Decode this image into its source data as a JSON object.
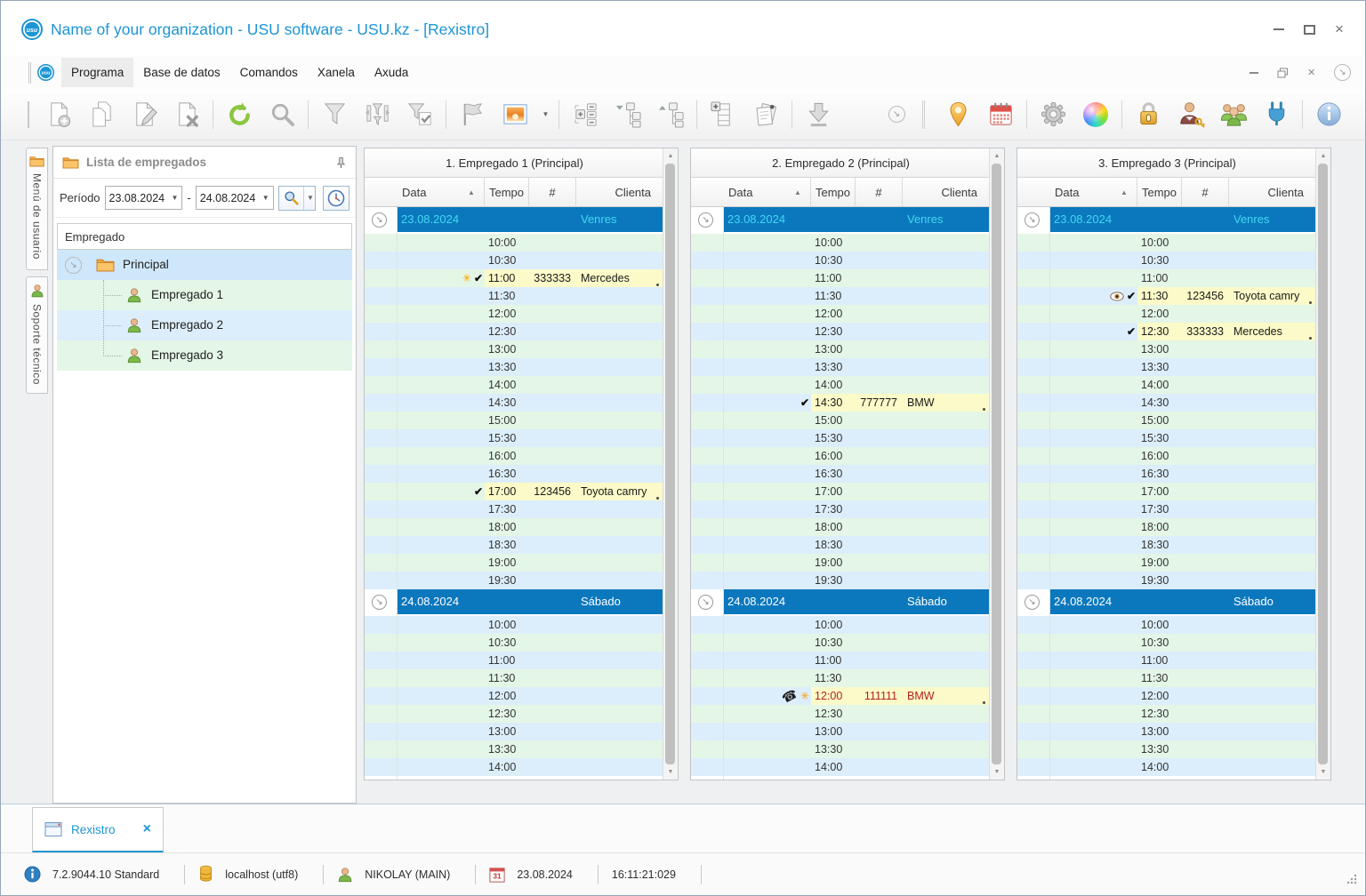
{
  "window": {
    "title": "Name of your organization - USU software - USU.kz - [Rexistro]"
  },
  "menu": {
    "items": [
      "Programa",
      "Base de datos",
      "Comandos",
      "Xanela",
      "Axuda"
    ],
    "active": "Programa"
  },
  "toolbar": {
    "icons": [
      "new-record",
      "copy-record",
      "edit-record",
      "delete-record",
      "refresh",
      "search",
      "filter",
      "filter-columns",
      "filter-apply",
      "flag",
      "image-preview",
      "dropdown",
      "row-expand",
      "tree-collapse",
      "tree-expand",
      "add-column",
      "reports",
      "import",
      "toolbar-overflow",
      "map-pin",
      "calendar",
      "settings",
      "color-scheme",
      "lock",
      "user-permissions",
      "employees",
      "plugins",
      "info",
      "toolbar-overflow"
    ]
  },
  "sidebar": {
    "tabs": [
      {
        "label": "Menú de usuario",
        "icon": "folder-icon"
      },
      {
        "label": "Soporte técnico",
        "icon": "user-icon"
      }
    ],
    "panel_title": "Lista de empregados",
    "period": {
      "label": "Período",
      "from": "23.08.2024",
      "to": "24.08.2024",
      "separator": "-"
    },
    "tree_header": "Empregado",
    "tree_root": "Principal",
    "employees": [
      "Empregado 1",
      "Empregado 2",
      "Empregado 3"
    ]
  },
  "schedule": {
    "columns": [
      "Data",
      "Tempo",
      "#",
      "Clienta"
    ],
    "day1_times": [
      "10:00",
      "10:30",
      "11:00",
      "11:30",
      "12:00",
      "12:30",
      "13:00",
      "13:30",
      "14:00",
      "14:30",
      "15:00",
      "15:30",
      "16:00",
      "16:30",
      "17:00",
      "17:30",
      "18:00",
      "18:30",
      "19:00",
      "19:30"
    ],
    "day2_times": [
      "10:00",
      "10:30",
      "11:00",
      "11:30",
      "12:00",
      "12:30",
      "13:00",
      "13:30",
      "14:00"
    ],
    "panels": [
      {
        "title": "1. Empregado 1 (Principal)",
        "days": [
          {
            "date": "23.08.2024",
            "weekday": "Venres",
            "current": true,
            "times": "day1",
            "entries": {
              "11:00": {
                "num": "333333",
                "client": "Mercedes",
                "icons": [
                  "asterisk",
                  "check"
                ]
              },
              "17:00": {
                "num": "123456",
                "client": "Toyota camry",
                "icons": [
                  "check"
                ]
              }
            }
          },
          {
            "date": "24.08.2024",
            "weekday": "Sábado",
            "current": false,
            "times": "day2",
            "entries": {}
          }
        ]
      },
      {
        "title": "2. Empregado 2 (Principal)",
        "days": [
          {
            "date": "23.08.2024",
            "weekday": "Venres",
            "current": true,
            "times": "day1",
            "entries": {
              "14:30": {
                "num": "777777",
                "client": "BMW",
                "icons": [
                  "check"
                ]
              }
            }
          },
          {
            "date": "24.08.2024",
            "weekday": "Sábado",
            "current": false,
            "times": "day2",
            "entries": {
              "12:00": {
                "num": "111111",
                "client": "BMW",
                "icons": [
                  "phone",
                  "asterisk"
                ],
                "color": "red"
              }
            }
          }
        ]
      },
      {
        "title": "3. Empregado 3 (Principal)",
        "days": [
          {
            "date": "23.08.2024",
            "weekday": "Venres",
            "current": true,
            "times": "day1",
            "entries": {
              "11:30": {
                "num": "123456",
                "client": "Toyota camry",
                "icons": [
                  "eye",
                  "check"
                ]
              },
              "12:30": {
                "num": "333333",
                "client": "Mercedes",
                "icons": [
                  "check"
                ]
              }
            }
          },
          {
            "date": "24.08.2024",
            "weekday": "Sábado",
            "current": false,
            "times": "day2",
            "entries": {}
          }
        ]
      }
    ]
  },
  "footer_tab": {
    "label": "Rexistro",
    "close": "×"
  },
  "statusbar": {
    "version": "7.2.9044.10 Standard",
    "database": "localhost (utf8)",
    "user": "NIKOLAY (MAIN)",
    "date": "23.08.2024",
    "time": "16:11:21:029"
  },
  "colors": {
    "accent": "#1e95d4",
    "group_header": "#0b78be",
    "current_day_text": "#41d8f0",
    "row_green": "#e4f6e6",
    "row_blue": "#dceefb",
    "appointment_yellow": "#fbfac8",
    "alert_red": "#b22222",
    "selected_tree_row": "#cfe7fa"
  }
}
